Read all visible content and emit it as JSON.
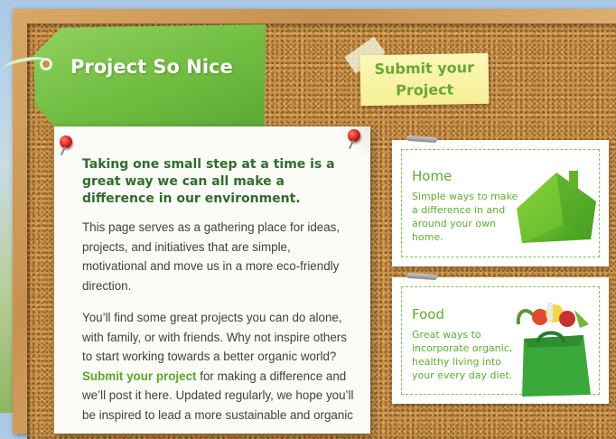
{
  "header": {
    "site_title": "Project So Nice",
    "submit_label": "Submit your Project"
  },
  "intro": {
    "lead": "Taking one small step at a time is a great way we can all make a difference in our environment.",
    "para1": "This page serves as a gathering place for ideas, projects, and initiatives that are simple, motivational and move us in a more eco-friendly direction.",
    "para2_before": "You’ll find some great projects you can do alone, with family, or with friends. Why not inspire others to start working towards a better organic world?",
    "para2_link": "Submit your project",
    "para2_after": "for making a difference and we’ll post it here. Updated regularly, we hope you’ll be inspired to lead a more sustainable and organic"
  },
  "cards": [
    {
      "title": "Home",
      "description": "Simple ways to make a difference in and around your own home.",
      "icon": "grass-house-icon"
    },
    {
      "title": "Food",
      "description": "Great ways to incorporate organic, healthy living into your every day diet.",
      "icon": "grocery-bag-icon"
    }
  ],
  "colors": {
    "accent_green": "#5ab02a",
    "heading_green": "#2e6e2a",
    "tag_green": "#6cba3e",
    "sticky_yellow": "#f5ef96",
    "pin_red": "#d21c1c"
  }
}
